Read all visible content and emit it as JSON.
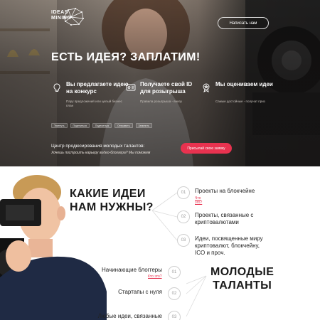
{
  "logo": {
    "line1": "IDEAS",
    "line2": "MINING"
  },
  "header": {
    "write_button": "Написать нам"
  },
  "hero": {
    "title": "ЕСТЬ ИДЕЯ? ЗАПЛАТИМ!",
    "features": [
      {
        "icon": "lightbulb-icon",
        "title": "Вы предлагаете идею на конкурс",
        "desc": "Пару предложений или целый бизнес план"
      },
      {
        "icon": "id-card-icon",
        "title": "Получаете свой ID для розыгрыша",
        "desc": "Правила розыгрыша - внизу"
      },
      {
        "icon": "medal-icon",
        "title": "Мы оцениваем идеи",
        "desc": "Самые достойные - получат приз"
      }
    ],
    "socials": [
      "Твитнуть",
      "Поделиться",
      "Поделиться",
      "Отправить",
      "Запинить"
    ],
    "center_title": "Центр продюсирования молодых талантов:",
    "center_sub": "Хочешь построить карьеру видео-блоггера? Мы поможем",
    "apply_button": "Присылай свою заявку"
  },
  "ideas_section": {
    "title_line1": "КАКИЕ ИДЕИ",
    "title_line2": "НАМ НУЖНЫ?",
    "items": [
      {
        "num": "01",
        "text": "Проекты на блокчейне",
        "link": "Что это?"
      },
      {
        "num": "02",
        "text": "Проекты, связанные с криптовалютами",
        "link": ""
      },
      {
        "num": "03",
        "text": "Идеи, посвященные миру криптовалют, блокчейну, ICO и проч.",
        "link": ""
      }
    ]
  },
  "talents_section": {
    "title_line1": "МОЛОДЫЕ",
    "title_line2": "ТАЛАНТЫ",
    "items": [
      {
        "num": "01",
        "text": "Начинающие блоггеры",
        "link": "Кто это?"
      },
      {
        "num": "02",
        "text": "Стартапы с нуля",
        "link": ""
      },
      {
        "num": "03",
        "text": "Любые идеи, связанные",
        "link": ""
      }
    ]
  }
}
